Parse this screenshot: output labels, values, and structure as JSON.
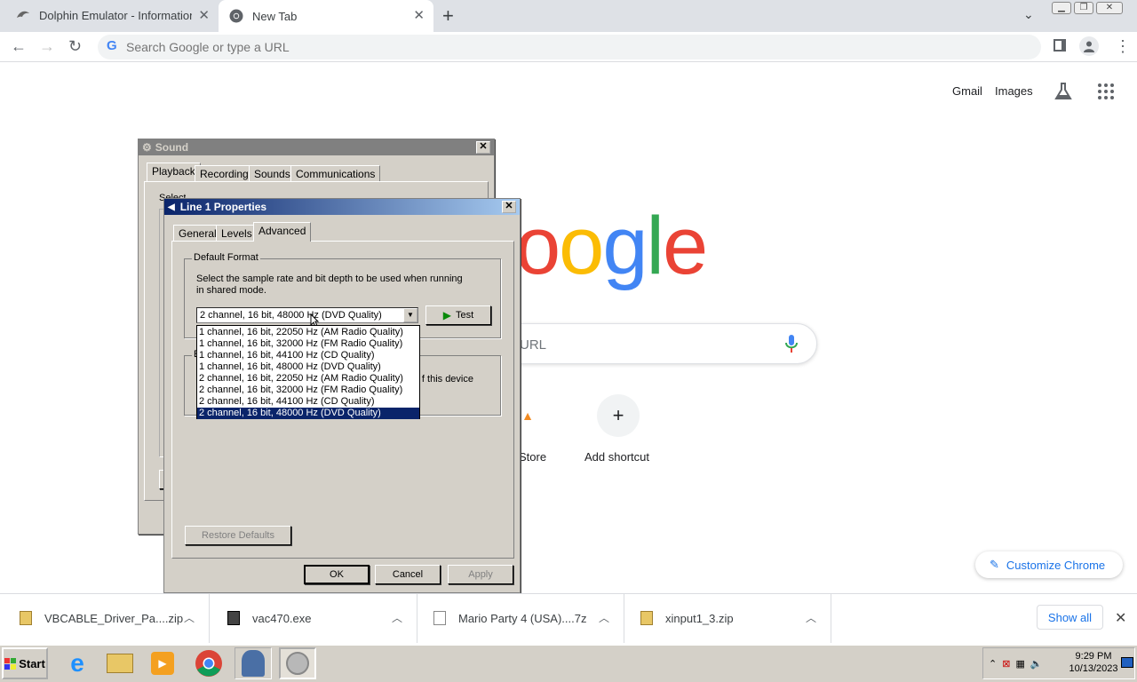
{
  "browser": {
    "tabs": [
      {
        "title": "Dolphin Emulator - Information c",
        "icon": "dolphin-icon"
      },
      {
        "title": "New Tab",
        "icon": "chrome-icon"
      }
    ],
    "new_tab_symbol": "+",
    "address_placeholder": "Search Google or type a URL"
  },
  "newtab": {
    "links": {
      "gmail": "Gmail",
      "images": "Images"
    },
    "logo_visible": "oogle",
    "search_placeholder": "URL",
    "shortcuts": [
      {
        "label": "Store"
      },
      {
        "label": "Add shortcut",
        "icon": "+"
      }
    ],
    "customize": "Customize Chrome"
  },
  "sound_dialog": {
    "title": "Sound",
    "tabs": [
      "Playback",
      "Recording",
      "Sounds",
      "Communications"
    ],
    "partial_text": "Select a playback device below to modify its settings:"
  },
  "props_dialog": {
    "title": "Line 1 Properties",
    "tabs": [
      "General",
      "Levels",
      "Advanced"
    ],
    "active_tab": "Advanced",
    "default_format": {
      "group": "Default Format",
      "description_line1": "Select the sample rate and bit depth to be used when running",
      "description_line2": "in shared mode.",
      "selected": "2 channel, 16 bit, 48000 Hz (DVD Quality)",
      "test_button": "Test",
      "options": [
        "1 channel, 16 bit, 22050 Hz (AM Radio Quality)",
        "1 channel, 16 bit, 32000 Hz (FM Radio Quality)",
        "1 channel, 16 bit, 44100 Hz (CD Quality)",
        "1 channel, 16 bit, 48000 Hz (DVD Quality)",
        "2 channel, 16 bit, 22050 Hz (AM Radio Quality)",
        "2 channel, 16 bit, 32000 Hz (FM Radio Quality)",
        "2 channel, 16 bit, 44100 Hz (CD Quality)",
        "2 channel, 16 bit, 48000 Hz (DVD Quality)"
      ]
    },
    "exclusive_partial_label": "E",
    "exclusive_partial_text": "f this device",
    "restore_defaults": "Restore Defaults",
    "ok": "OK",
    "cancel": "Cancel",
    "apply": "Apply"
  },
  "downloads": {
    "items": [
      "VBCABLE_Driver_Pa....zip",
      "vac470.exe",
      "Mario Party 4 (USA)....7z",
      "xinput1_3.zip"
    ],
    "show_all": "Show all"
  },
  "taskbar": {
    "start": "Start",
    "time": "9:29 PM",
    "date": "10/13/2023"
  }
}
